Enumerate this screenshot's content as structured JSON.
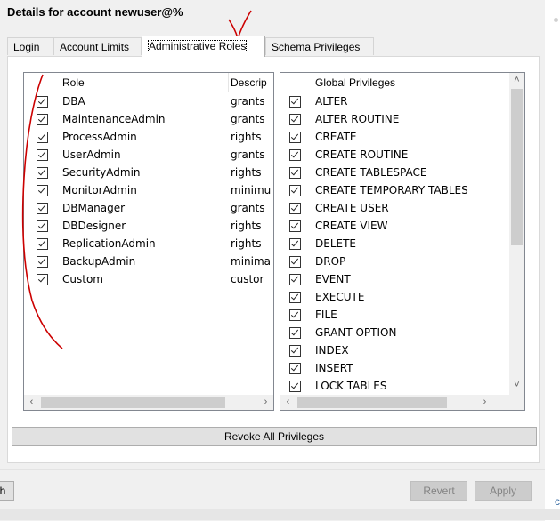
{
  "window": {
    "title": "Details for account newuser@%"
  },
  "tabs": [
    {
      "label": "Login",
      "active": false
    },
    {
      "label": "Account Limits",
      "active": false
    },
    {
      "label": "Administrative Roles",
      "active": true
    },
    {
      "label": "Schema Privileges",
      "active": false
    }
  ],
  "roles_list": {
    "columns": [
      "Role",
      "Descrip"
    ],
    "rows": [
      {
        "role": "DBA",
        "description": "grants",
        "checked": true
      },
      {
        "role": "MaintenanceAdmin",
        "description": "grants",
        "checked": true
      },
      {
        "role": "ProcessAdmin",
        "description": "rights",
        "checked": true
      },
      {
        "role": "UserAdmin",
        "description": "grants",
        "checked": true
      },
      {
        "role": "SecurityAdmin",
        "description": "rights",
        "checked": true
      },
      {
        "role": "MonitorAdmin",
        "description": "minimu",
        "checked": true
      },
      {
        "role": "DBManager",
        "description": "grants",
        "checked": true
      },
      {
        "role": "DBDesigner",
        "description": "rights",
        "checked": true
      },
      {
        "role": "ReplicationAdmin",
        "description": "rights",
        "checked": true
      },
      {
        "role": "BackupAdmin",
        "description": "minima",
        "checked": true
      },
      {
        "role": "Custom",
        "description": "custor",
        "checked": true
      }
    ]
  },
  "privileges_list": {
    "header": "Global Privileges",
    "rows": [
      {
        "label": "ALTER",
        "checked": true
      },
      {
        "label": "ALTER ROUTINE",
        "checked": true
      },
      {
        "label": "CREATE",
        "checked": true
      },
      {
        "label": "CREATE ROUTINE",
        "checked": true
      },
      {
        "label": "CREATE TABLESPACE",
        "checked": true
      },
      {
        "label": "CREATE TEMPORARY TABLES",
        "checked": true
      },
      {
        "label": "CREATE USER",
        "checked": true
      },
      {
        "label": "CREATE VIEW",
        "checked": true
      },
      {
        "label": "DELETE",
        "checked": true
      },
      {
        "label": "DROP",
        "checked": true
      },
      {
        "label": "EVENT",
        "checked": true
      },
      {
        "label": "EXECUTE",
        "checked": true
      },
      {
        "label": "FILE",
        "checked": true
      },
      {
        "label": "GRANT OPTION",
        "checked": true
      },
      {
        "label": "INDEX",
        "checked": true
      },
      {
        "label": "INSERT",
        "checked": true
      },
      {
        "label": "LOCK TABLES",
        "checked": true
      }
    ]
  },
  "buttons": {
    "revoke_all": "Revoke All Privileges",
    "left_partial": "h",
    "revert": "Revert",
    "apply": "Apply"
  },
  "right_edge_text": "c",
  "icons": {
    "scroll_left": "‹",
    "scroll_right": "›",
    "scroll_up": "˄",
    "scroll_down": "˅"
  },
  "colors": {
    "annotation": "#cc0000"
  }
}
